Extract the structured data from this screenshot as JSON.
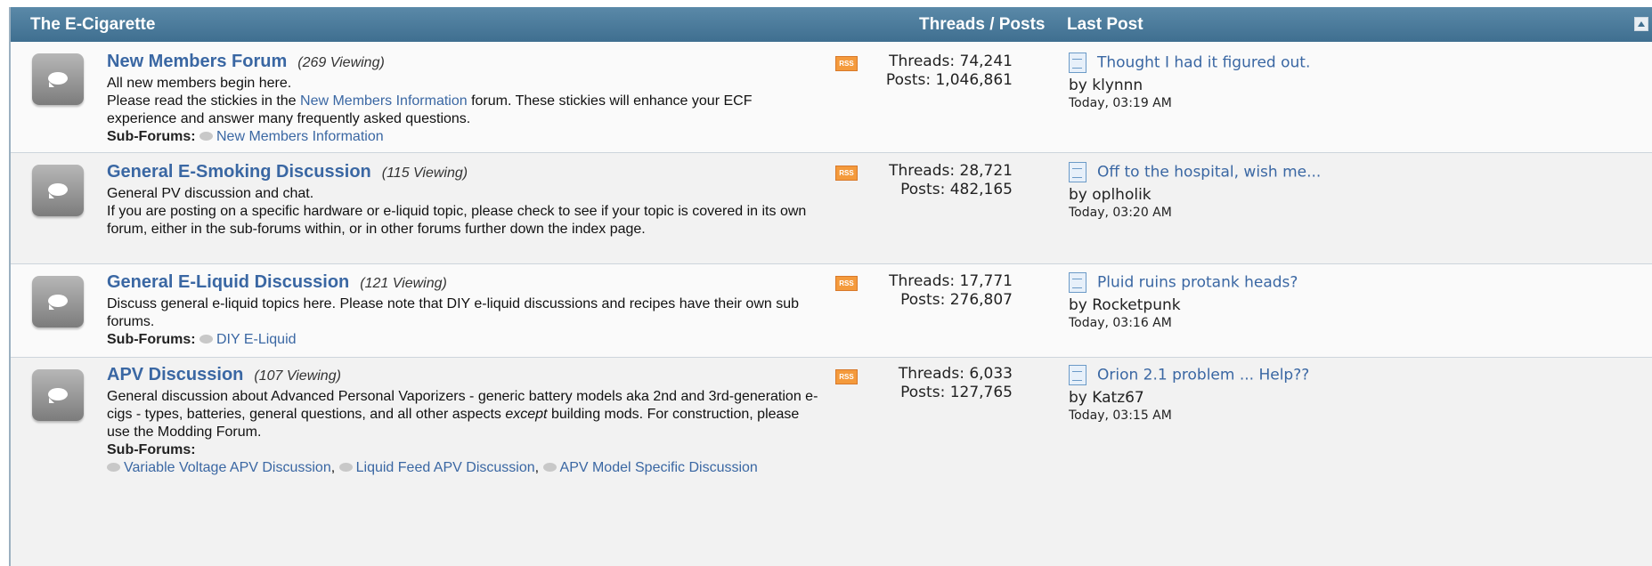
{
  "header": {
    "category_title": "The E-Cigarette",
    "threads_posts_label": "Threads / Posts",
    "last_post_label": "Last Post"
  },
  "forums": [
    {
      "name": "New Members Forum",
      "viewing": "(269 Viewing)",
      "desc_line1": "All new members begin here.",
      "desc_pre": "Please read the stickies in the ",
      "desc_link": "New Members Information",
      "desc_post": " forum. These stickies will enhance your ECF experience and answer many frequently asked questions.",
      "subforums_label": "Sub-Forums:",
      "subforums": [
        "New Members Information"
      ],
      "rss_label": "RSS",
      "threads": "Threads: 74,241",
      "posts": "Posts: 1,046,861",
      "last_post_title": "Thought I had it figured out.",
      "last_post_by": "by klynnn",
      "last_post_time": "Today, 03:19 AM"
    },
    {
      "name": "General E-Smoking Discussion",
      "viewing": "(115 Viewing)",
      "desc_line1": "General PV discussion and chat.",
      "desc_line2": "If you are posting on a specific hardware or e-liquid topic, please check to see if your topic is covered in its own forum, either in the sub-forums within, or in other forums further down the index page.",
      "rss_label": "RSS",
      "threads": "Threads: 28,721",
      "posts": "Posts: 482,165",
      "last_post_title": "Off to the hospital, wish me...",
      "last_post_by": "by oplholik",
      "last_post_time": "Today, 03:20 AM"
    },
    {
      "name": "General E-Liquid Discussion",
      "viewing": "(121 Viewing)",
      "desc_line1": "Discuss general e-liquid topics here. Please note that DIY e-liquid discussions and recipes have their own sub forums.",
      "subforums_label": "Sub-Forums:",
      "subforums": [
        "DIY E-Liquid"
      ],
      "rss_label": "RSS",
      "threads": "Threads: 17,771",
      "posts": "Posts: 276,807",
      "last_post_title": "Pluid ruins protank heads?",
      "last_post_by": "by Rocketpunk",
      "last_post_time": "Today, 03:16 AM"
    },
    {
      "name": "APV Discussion",
      "viewing": "(107 Viewing)",
      "desc_pre": "General discussion about Advanced Personal Vaporizers - generic battery models aka 2nd and 3rd-generation e-cigs - types, batteries, general questions, and all other aspects ",
      "desc_em": "except",
      "desc_post": " building mods. For construction, please use the Modding Forum.",
      "subforums_label": "Sub-Forums:",
      "subforums": [
        "Variable Voltage APV Discussion",
        "Liquid Feed APV Discussion",
        "APV Model Specific Discussion"
      ],
      "rss_label": "RSS",
      "threads": "Threads: 6,033",
      "posts": "Posts: 127,765",
      "last_post_title": "Orion 2.1 problem ... Help??",
      "last_post_by": "by Katz67",
      "last_post_time": "Today, 03:15 AM"
    }
  ]
}
